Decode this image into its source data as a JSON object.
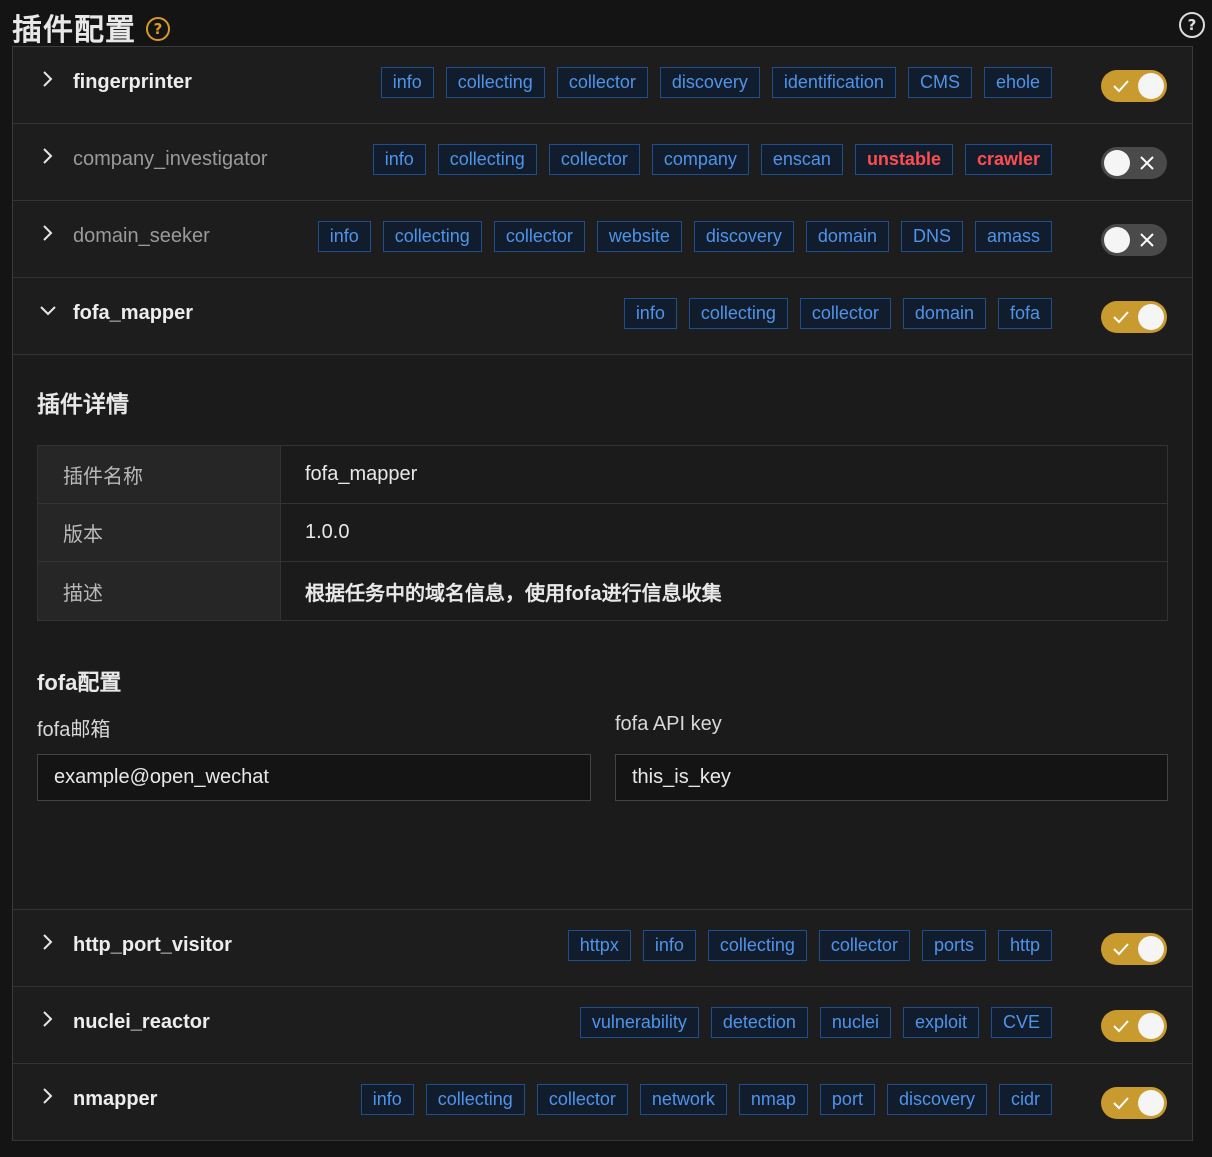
{
  "page": {
    "title": "插件配置",
    "help_icon": "question-circle-icon",
    "top_help_icon": "question-circle-icon"
  },
  "colors": {
    "accent": "#c99a2e",
    "tag_text": "#4f93ea",
    "tag_border": "#1e4f8c",
    "danger": "#ff4d4f"
  },
  "plugins": [
    {
      "name": "fingerprinter",
      "enabled": true,
      "expanded": false,
      "tags": [
        {
          "t": "info"
        },
        {
          "t": "collecting"
        },
        {
          "t": "collector"
        },
        {
          "t": "discovery"
        },
        {
          "t": "identification"
        },
        {
          "t": "CMS"
        },
        {
          "t": "ehole"
        }
      ]
    },
    {
      "name": "company_investigator",
      "enabled": false,
      "expanded": false,
      "tags": [
        {
          "t": "info"
        },
        {
          "t": "collecting"
        },
        {
          "t": "collector"
        },
        {
          "t": "company"
        },
        {
          "t": "enscan"
        },
        {
          "t": "unstable",
          "danger": true
        },
        {
          "t": "crawler",
          "danger": true
        }
      ]
    },
    {
      "name": "domain_seeker",
      "enabled": false,
      "expanded": false,
      "tags": [
        {
          "t": "info"
        },
        {
          "t": "collecting"
        },
        {
          "t": "collector"
        },
        {
          "t": "website"
        },
        {
          "t": "discovery"
        },
        {
          "t": "domain"
        },
        {
          "t": "DNS"
        },
        {
          "t": "amass"
        }
      ]
    },
    {
      "name": "fofa_mapper",
      "enabled": true,
      "expanded": true,
      "tags": [
        {
          "t": "info"
        },
        {
          "t": "collecting"
        },
        {
          "t": "collector"
        },
        {
          "t": "domain"
        },
        {
          "t": "fofa"
        }
      ]
    },
    {
      "name": "http_port_visitor",
      "enabled": true,
      "expanded": false,
      "tags": [
        {
          "t": "httpx"
        },
        {
          "t": "info"
        },
        {
          "t": "collecting"
        },
        {
          "t": "collector"
        },
        {
          "t": "ports"
        },
        {
          "t": "http"
        }
      ]
    },
    {
      "name": "nuclei_reactor",
      "enabled": true,
      "expanded": false,
      "tags": [
        {
          "t": "vulnerability"
        },
        {
          "t": "detection"
        },
        {
          "t": "nuclei"
        },
        {
          "t": "exploit"
        },
        {
          "t": "CVE"
        }
      ]
    },
    {
      "name": "nmapper",
      "enabled": true,
      "expanded": false,
      "tags": [
        {
          "t": "info"
        },
        {
          "t": "collecting"
        },
        {
          "t": "collector"
        },
        {
          "t": "network"
        },
        {
          "t": "nmap"
        },
        {
          "t": "port"
        },
        {
          "t": "discovery"
        },
        {
          "t": "cidr"
        }
      ]
    }
  ],
  "detail": {
    "title": "插件详情",
    "rows": [
      {
        "key": "插件名称",
        "value": "fofa_mapper"
      },
      {
        "key": "版本",
        "value": "1.0.0"
      },
      {
        "key": "描述",
        "value": "根据任务中的域名信息，使用fofa进行信息收集"
      }
    ],
    "config_title": "fofa配置",
    "fields": [
      {
        "label": "fofa邮箱",
        "value": "example@open_wechat"
      },
      {
        "label": "fofa API key",
        "value": "this_is_key"
      }
    ]
  }
}
